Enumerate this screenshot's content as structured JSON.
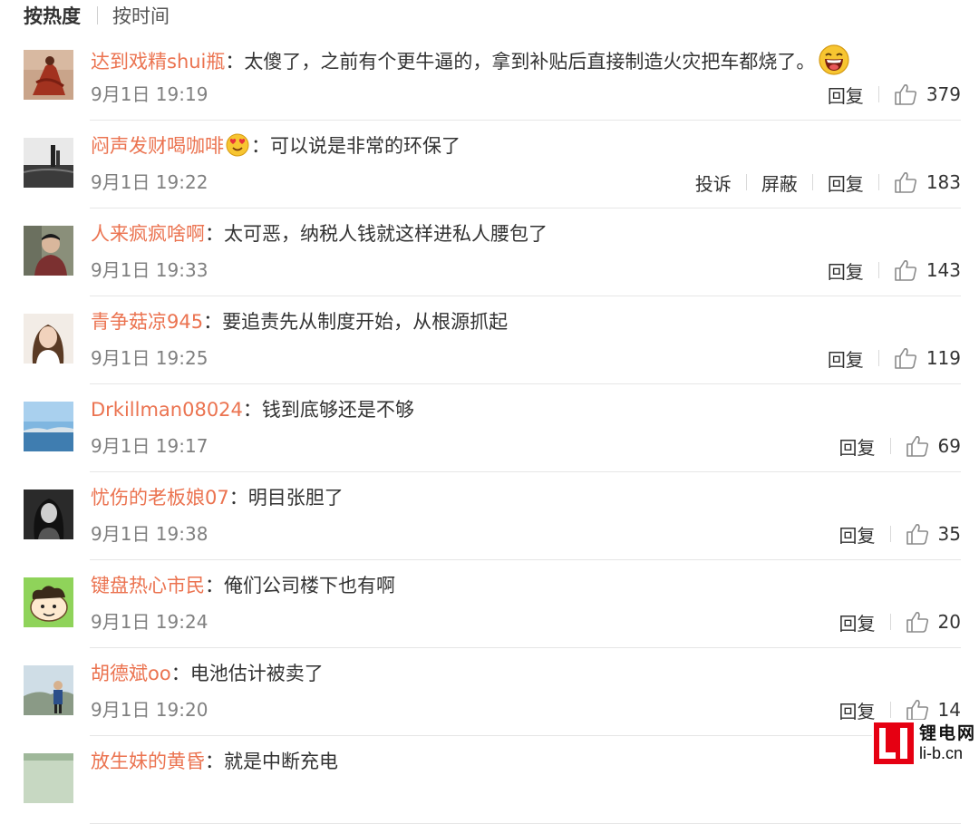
{
  "sort_tabs": {
    "hot": "按热度",
    "time": "按时间"
  },
  "actions": {
    "report": "投诉",
    "block": "屏蔽",
    "reply": "回复"
  },
  "comments": [
    {
      "username": "达到戏精shui瓶",
      "sep": "：",
      "text": "太傻了，之前有个更牛逼的，拿到补贴后直接制造火灾把车都烧了。",
      "time": "9月1日 19:19",
      "likes": "379"
    },
    {
      "username": "闷声发财喝咖啡",
      "sep": "：",
      "text": "可以说是非常的环保了",
      "time": "9月1日 19:22",
      "likes": "183"
    },
    {
      "username": "人来疯疯啥啊",
      "sep": "：",
      "text": "太可恶，纳税人钱就这样进私人腰包了",
      "time": "9月1日 19:33",
      "likes": "143"
    },
    {
      "username": "青争菇凉945",
      "sep": "：",
      "text": "要追责先从制度开始，从根源抓起",
      "time": "9月1日 19:25",
      "likes": "119"
    },
    {
      "username": "Drkillman08024",
      "sep": "：",
      "text": "钱到底够还是不够",
      "time": "9月1日 19:17",
      "likes": "69"
    },
    {
      "username": "忧伤的老板娘07",
      "sep": "：",
      "text": "明目张胆了",
      "time": "9月1日 19:38",
      "likes": "35"
    },
    {
      "username": "键盘热心市民",
      "sep": "：",
      "text": "俺们公司楼下也有啊",
      "time": "9月1日 19:24",
      "likes": "20"
    },
    {
      "username": "胡德斌oo",
      "sep": "：",
      "text": "电池估计被卖了",
      "time": "9月1日 19:20",
      "likes": "14"
    },
    {
      "username": "放生妹的黄昏",
      "sep": "：",
      "text": "就是中断充电",
      "time": "",
      "likes": ""
    }
  ],
  "watermark": {
    "logo": "LI",
    "name": "锂电网",
    "domain": "li-b.cn"
  },
  "colors": {
    "username": "#eb7350",
    "text": "#333333",
    "meta": "#808080",
    "divider": "#e6e6e6",
    "watermark_red": "#e60012"
  },
  "icons": {
    "like": "thumbs-up-icon",
    "laugh": "laughing-emoji-icon",
    "badge": "heart-eyes-emoji-icon"
  }
}
